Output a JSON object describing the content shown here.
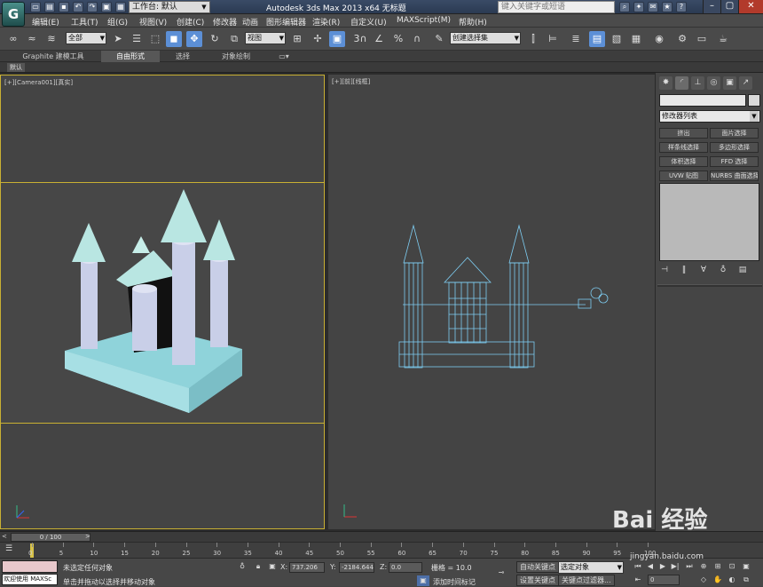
{
  "titlebar": {
    "workspace_label": "工作台: 默认",
    "window_title": "Autodesk 3ds Max  2013 x64      无标题",
    "search_placeholder": "键入关键字或短语"
  },
  "menu": {
    "items": [
      "编辑(E)",
      "工具(T)",
      "组(G)",
      "视图(V)",
      "创建(C)",
      "修改器",
      "动画",
      "图形编辑器",
      "渲染(R)",
      "自定义(U)",
      "MAXScript(M)",
      "帮助(H)"
    ]
  },
  "toolbar": {
    "filter_select": "全部",
    "refcoord_select": "视图",
    "named_selection": "创建选择集",
    "snap_label": "3"
  },
  "ribbon": {
    "tabs": [
      "Graphite 建模工具",
      "自由形式",
      "选择",
      "对象绘制"
    ],
    "default_chip": "默认"
  },
  "viewports": {
    "left_label": "[+][Camera001][真实]",
    "right_label": "[+][前][线框]"
  },
  "command_panel": {
    "modifier_list": "修改器列表",
    "buttons": [
      "挤出",
      "面片选择",
      "样条线选择",
      "多边形选择",
      "体积选择",
      "FFD 选择",
      "UVW 贴图",
      "NURBS 曲面选择"
    ]
  },
  "timeslider": {
    "position": "0 / 100"
  },
  "trackbar": {
    "ticks": [
      "0",
      "5",
      "10",
      "15",
      "20",
      "25",
      "30",
      "35",
      "40",
      "45",
      "50",
      "55",
      "60",
      "65",
      "70",
      "75",
      "80",
      "85",
      "90",
      "95",
      "100"
    ]
  },
  "status": {
    "welcome": "欢迎使用 MAXSc",
    "line1": "未选定任何对象",
    "line2": "单击并拖动以选择并移动对象",
    "x_label": "X:",
    "x_value": "737.206",
    "y_label": "Y:",
    "y_value": "-2184.644",
    "z_label": "Z:",
    "z_value": "0.0",
    "grid": "栅格 = 10.0",
    "add_time_tag": "添加时间标记",
    "auto_key": "自动关键点",
    "set_key": "设置关键点",
    "selection_set": "选定对象",
    "key_filters": "关键点过滤器...",
    "frame_value": "0"
  },
  "watermark": {
    "brand": "Bai 经验",
    "url": "jingyan.baidu.com"
  },
  "colors": {
    "castle_base": "#8fd3da",
    "tower_body": "#c9cfe8",
    "roof": "#b9e6e2",
    "wire": "#7ecdf2",
    "active_border": "#c9b033",
    "selected_tool": "#5c8fd6"
  }
}
